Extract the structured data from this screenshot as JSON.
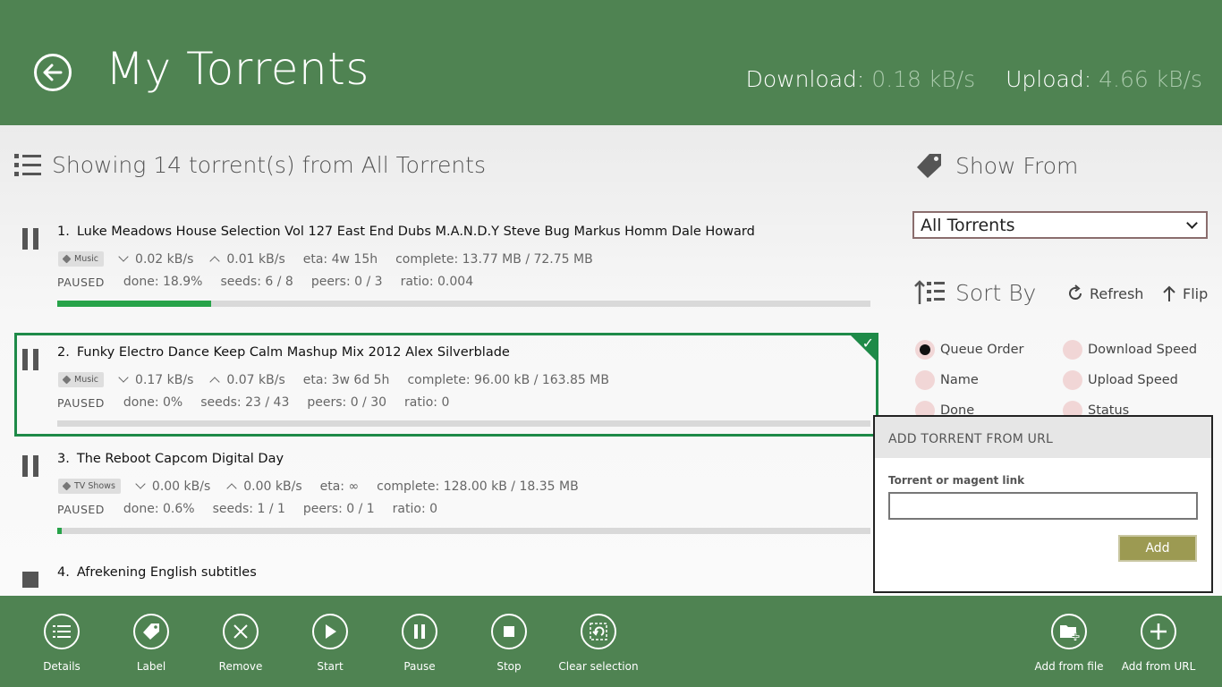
{
  "header": {
    "title": "My Torrents",
    "download_label": "Download:",
    "download_value": "0.18 kB/s",
    "upload_label": "Upload:",
    "upload_value": "4.66 kB/s",
    "back_icon": "back-arrow-icon"
  },
  "list": {
    "heading": "Showing 14 torrent(s) from All Torrents",
    "torrents": [
      {
        "num": "1.",
        "name": "Luke Meadows House Selection Vol 127 East End Dubs M.A.N.D.Y Steve Bug Markus Homm Dale Howard",
        "label": "Music",
        "down": "0.02 kB/s",
        "up": "0.01 kB/s",
        "eta": "eta: 4w 15h",
        "complete": "complete: 13.77 MB / 72.75 MB",
        "status": "PAUSED",
        "done": "done:  18.9%",
        "seeds": "seeds:  6 / 8",
        "peers": "peers: 0 / 3",
        "ratio": "ratio: 0.004",
        "progress": 0.189
      },
      {
        "num": "2.",
        "name": "Funky Electro Dance Keep Calm Mashup Mix 2012 Alex Silverblade",
        "label": "Music",
        "down": "0.17 kB/s",
        "up": "0.07 kB/s",
        "eta": "eta: 3w 6d 5h",
        "complete": "complete: 96.00 kB / 163.85 MB",
        "status": "PAUSED",
        "done": "done:  0%",
        "seeds": "seeds:  23 / 43",
        "peers": "peers: 0 / 30",
        "ratio": "ratio: 0",
        "progress": 0.0
      },
      {
        "num": "3.",
        "name": "The Reboot Capcom Digital Day",
        "label": "TV Shows",
        "down": "0.00 kB/s",
        "up": "0.00 kB/s",
        "eta": "eta: ∞",
        "complete": "complete: 128.00 kB / 18.35 MB",
        "status": "PAUSED",
        "done": "done:  0.6%",
        "seeds": "seeds:  1 / 1",
        "peers": "peers: 0 / 1",
        "ratio": "ratio: 0",
        "progress": 0.006
      },
      {
        "num": "4.",
        "name": "Afrekening English subtitles"
      }
    ]
  },
  "side": {
    "show_from": "Show From",
    "dropdown_value": "All Torrents",
    "sort_by": "Sort By",
    "refresh": "Refresh",
    "flip": "Flip",
    "sort_options": [
      "Queue Order",
      "Download Speed",
      "Name",
      "Upload Speed",
      "Done",
      "Status"
    ],
    "selected_sort": "Queue Order"
  },
  "popup": {
    "title": "ADD TORRENT FROM URL",
    "field_label": "Torrent or magent link",
    "field_value": "",
    "add_button": "Add"
  },
  "appbar": {
    "details": "Details",
    "label": "Label",
    "remove": "Remove",
    "start": "Start",
    "pause": "Pause",
    "stop": "Stop",
    "clear_selection": "Clear selection",
    "add_from_file": "Add from file",
    "add_from_url": "Add from URL"
  },
  "colors": {
    "header_green": "#4f8352",
    "progress_green": "#27a349",
    "selection_green": "#1e8a48",
    "add_button": "#9c9a52"
  }
}
